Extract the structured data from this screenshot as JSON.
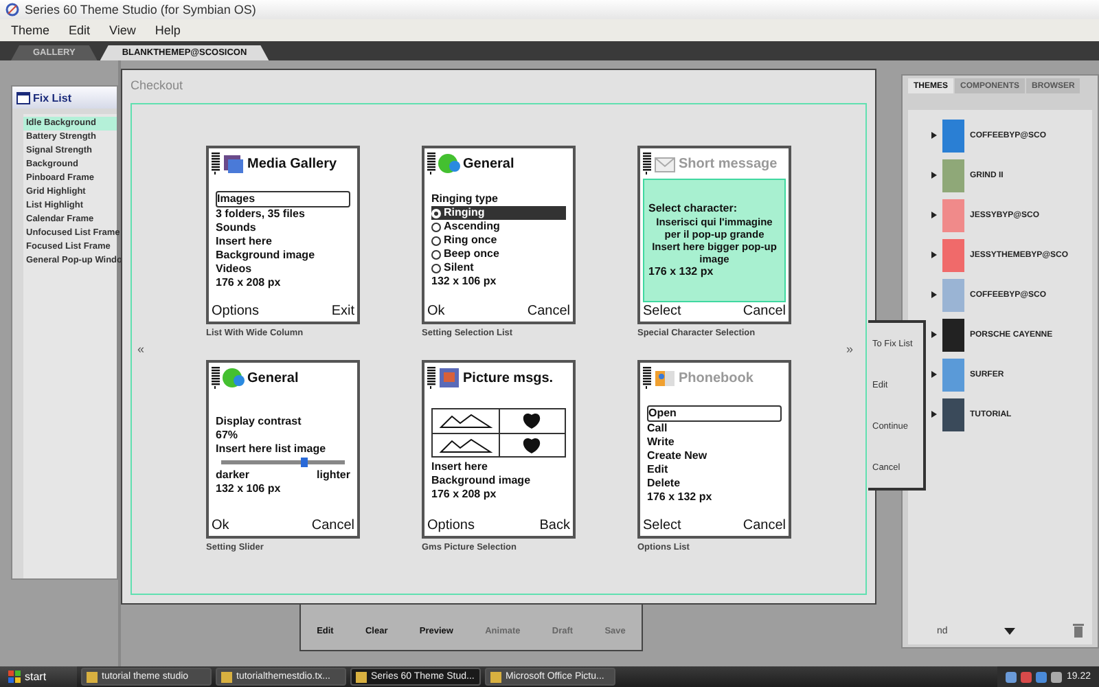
{
  "window": {
    "title": "Series 60 Theme Studio (for Symbian OS)"
  },
  "menu": [
    "Theme",
    "Edit",
    "View",
    "Help"
  ],
  "doc_tabs": [
    {
      "label": "GALLERY",
      "selected": false
    },
    {
      "label": "BLANKTHEMEP@SCOSICON",
      "selected": true
    }
  ],
  "fix_list": {
    "title": "Fix List",
    "items": [
      {
        "label": "Idle Background",
        "selected": true
      },
      {
        "label": "Battery Strength",
        "selected": false
      },
      {
        "label": "Signal Strength",
        "selected": false
      },
      {
        "label": "Background",
        "selected": false
      },
      {
        "label": "Pinboard Frame",
        "selected": false
      },
      {
        "label": "Grid Highlight",
        "selected": false
      },
      {
        "label": "List Highlight",
        "selected": false
      },
      {
        "label": "Calendar Frame",
        "selected": false
      },
      {
        "label": "Unfocused List Frame",
        "selected": false
      },
      {
        "label": "Focused List Frame",
        "selected": false
      },
      {
        "label": "General Pop-up Windo",
        "selected": false
      }
    ]
  },
  "checkout": {
    "title": "Checkout",
    "prev": "«",
    "next": "»",
    "phones": [
      {
        "kind": "list",
        "title": "Media Gallery",
        "items": [
          {
            "kind": "menu",
            "text": "Images",
            "selected": true
          },
          {
            "kind": "text",
            "text": "3 folders, 35 files"
          },
          {
            "kind": "text",
            "text": "Sounds"
          },
          {
            "kind": "text",
            "text": "Insert here"
          },
          {
            "kind": "text",
            "text": "Background image"
          },
          {
            "kind": "text",
            "text": "Videos"
          },
          {
            "kind": "text",
            "text": "176 x 208 px"
          }
        ],
        "left_key": "Options",
        "right_key": "Exit",
        "caption": "List With Wide Column"
      },
      {
        "kind": "radio",
        "title": "General",
        "items": [
          {
            "kind": "text",
            "text": "Ringing type"
          },
          {
            "kind": "radio",
            "text": "Ringing",
            "selected": true
          },
          {
            "kind": "radio",
            "text": "Ascending",
            "selected": false
          },
          {
            "kind": "radio",
            "text": "Ring once",
            "selected": false
          },
          {
            "kind": "radio",
            "text": "Beep once",
            "selected": false
          },
          {
            "kind": "radio",
            "text": "Silent",
            "selected": false
          },
          {
            "kind": "text",
            "text": "132 x 106 px"
          }
        ],
        "left_key": "Ok",
        "right_key": "Cancel",
        "caption": "Setting Selection List"
      },
      {
        "kind": "charmap",
        "title": "Short message",
        "items": [
          {
            "kind": "text",
            "text": "Select character:"
          },
          {
            "kind": "text",
            "text": "Inserisci qui l'immagine per il pop-up grande"
          },
          {
            "kind": "text",
            "text": "Insert here bigger pop-up image"
          },
          {
            "kind": "text",
            "text": "176 x 132 px"
          }
        ],
        "left_key": "Select",
        "right_key": "Cancel",
        "caption": "Special Character Selection"
      },
      {
        "kind": "slider",
        "title": "General",
        "items": [
          {
            "kind": "text",
            "text": "Display contrast"
          },
          {
            "kind": "text",
            "text": "67%"
          },
          {
            "kind": "text",
            "text": "Insert here list image"
          },
          {
            "kind": "text",
            "text": "132 x 106 px"
          }
        ],
        "slider": {
          "level": 0.67,
          "min_label": "darker",
          "max_label": "lighter"
        },
        "left_key": "Ok",
        "right_key": "Cancel",
        "caption": "Setting Slider"
      },
      {
        "kind": "pictures",
        "title": "Picture msgs.",
        "items": [
          {
            "kind": "text",
            "text": "Insert here"
          },
          {
            "kind": "text",
            "text": "Background image"
          },
          {
            "kind": "text",
            "text": "176 x 208 px"
          }
        ],
        "left_key": "Options",
        "right_key": "Back",
        "caption": "Gms Picture Selection"
      },
      {
        "kind": "options",
        "title": "Phonebook",
        "items": [
          {
            "kind": "menu",
            "text": "Open",
            "selected": true
          },
          {
            "kind": "menu",
            "text": "Call",
            "selected": false
          },
          {
            "kind": "menu",
            "text": "Write",
            "selected": false
          },
          {
            "kind": "menu",
            "text": "Create New",
            "selected": false
          },
          {
            "kind": "menu",
            "text": "Edit",
            "selected": false
          },
          {
            "kind": "menu",
            "text": "Delete",
            "selected": false
          },
          {
            "kind": "text",
            "text": "176 x 132 px"
          }
        ],
        "left_key": "Select",
        "right_key": "Cancel",
        "caption": "Options List"
      }
    ]
  },
  "toolbar": [
    {
      "label": "Edit",
      "disabled": false
    },
    {
      "label": "Clear",
      "disabled": false
    },
    {
      "label": "Preview",
      "disabled": false
    },
    {
      "label": "Animate",
      "disabled": true
    },
    {
      "label": "Draft",
      "disabled": true
    },
    {
      "label": "Save",
      "disabled": true
    }
  ],
  "popup_menu": [
    "To Fix List",
    "Edit",
    "Continue",
    "Cancel"
  ],
  "themes_panel": {
    "tabs": [
      {
        "label": "THEMES",
        "selected": true
      },
      {
        "label": "COMPONENTS",
        "selected": false
      },
      {
        "label": "BROWSER",
        "selected": false
      }
    ],
    "items": [
      {
        "name": "COFFEEBYP@SCO",
        "color": "#2a7fd4"
      },
      {
        "name": "GRIND II",
        "color": "#8fa878"
      },
      {
        "name": "JESSYBYP@SCO",
        "color": "#f08a8a"
      },
      {
        "name": "JESSYTHEMEBYP@SCO",
        "color": "#f06a6a"
      },
      {
        "name": "COFFEEBYP@SCO",
        "color": "#9ab4d4"
      },
      {
        "name": "PORSCHE CAYENNE",
        "color": "#222222"
      },
      {
        "name": "SURFER",
        "color": "#5a9ad8"
      },
      {
        "name": "TUTORIAL",
        "color": "#3a4a5a"
      }
    ],
    "footer_text": "nd"
  },
  "taskbar": {
    "start": "start",
    "tasks": [
      {
        "label": "tutorial theme studio",
        "selected": false
      },
      {
        "label": "tutorialthemestdio.tx...",
        "selected": false
      },
      {
        "label": "Series 60 Theme Stud...",
        "selected": true
      },
      {
        "label": "Microsoft Office Pictu...",
        "selected": false
      }
    ],
    "clock": "19.22"
  }
}
